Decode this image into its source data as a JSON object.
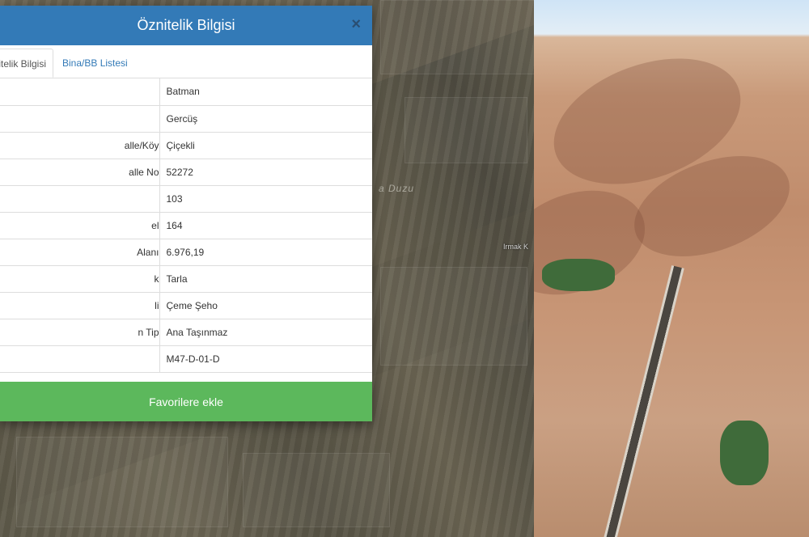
{
  "panel": {
    "title": "Öznitelik Bilgisi",
    "close_symbol": "×",
    "tabs": [
      {
        "label": "Öznitelik Bilgisi",
        "visible_text": "itelik Bilgisi",
        "active": true
      },
      {
        "label": "Bina/BB Listesi",
        "active": false
      }
    ],
    "rows": [
      {
        "key": "",
        "value": "Batman"
      },
      {
        "key": "",
        "value": "Gercüş"
      },
      {
        "key": "alle/Köy",
        "value": "Çiçekli"
      },
      {
        "key": "alle No",
        "value": "52272"
      },
      {
        "key": "",
        "value": "103"
      },
      {
        "key": "el",
        "value": "164"
      },
      {
        "key": "Alanı",
        "value": "6.976,19"
      },
      {
        "key": "k",
        "value": "Tarla"
      },
      {
        "key": "li",
        "value": "Çeme Şeho"
      },
      {
        "key": "n Tip",
        "value": "Ana Taşınmaz"
      },
      {
        "key": "",
        "value": "M47-D-01-D"
      }
    ],
    "favorite_button": "Favorilere ekle"
  },
  "map": {
    "label_duzu": "a Duzu",
    "label_irmak": "Irmak K"
  },
  "colors": {
    "header": "#337ab7",
    "favorite": "#5cb85c",
    "tab_link": "#337ab7"
  }
}
